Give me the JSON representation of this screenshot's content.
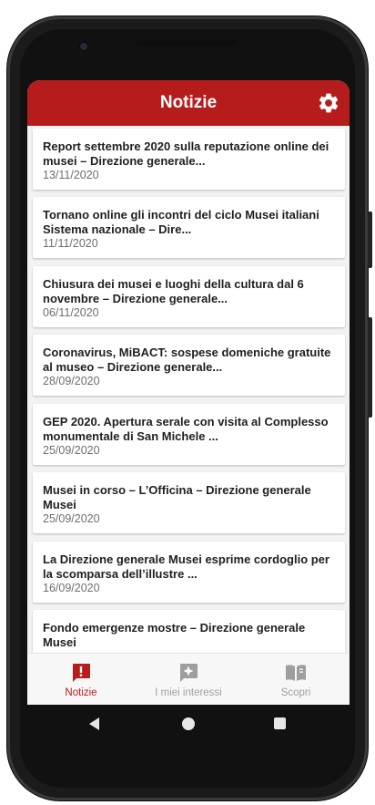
{
  "appbar": {
    "title": "Notizie"
  },
  "news": [
    {
      "title": "Report settembre 2020 sulla reputazione online dei musei – Direzione generale...",
      "date": "13/11/2020"
    },
    {
      "title": "Tornano online gli incontri del ciclo Musei italiani Sistema nazionale – Dire...",
      "date": "11/11/2020"
    },
    {
      "title": "Chiusura dei musei e luoghi della cultura dal 6 novembre – Direzione generale...",
      "date": "06/11/2020"
    },
    {
      "title": "Coronavirus, MiBACT: sospese domeniche gratuite al museo – Direzione generale...",
      "date": "28/09/2020"
    },
    {
      "title": "GEP 2020. Apertura serale con visita al Complesso monumentale di San Michele ...",
      "date": "25/09/2020"
    },
    {
      "title": "Musei in corso – L’Officina – Direzione generale Musei",
      "date": "25/09/2020"
    },
    {
      "title": "La Direzione generale Musei esprime cordoglio per la scomparsa dell’illustre ...",
      "date": "16/09/2020"
    },
    {
      "title": "Fondo emergenze mostre – Direzione generale Musei",
      "date": ""
    }
  ],
  "bottom_nav": {
    "items": [
      {
        "label": "Notizie",
        "icon": "alert-chat-icon",
        "active": true
      },
      {
        "label": "I miei interessi",
        "icon": "sparkle-chat-icon",
        "active": false
      },
      {
        "label": "Scopri",
        "icon": "open-book-icon",
        "active": false
      }
    ]
  },
  "colors": {
    "accent": "#b71c1c",
    "inactive": "#9e9e9e"
  }
}
